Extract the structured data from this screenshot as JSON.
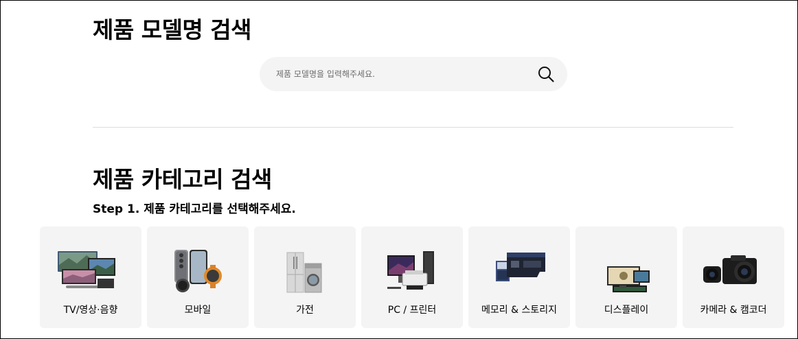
{
  "model_search": {
    "title": "제품 모델명 검색",
    "placeholder": "제품 모델명을 입력해주세요."
  },
  "category_search": {
    "title": "제품 카테고리 검색",
    "step": "Step 1. 제품 카테고리를 선택해주세요.",
    "categories": [
      {
        "label": "TV/영상·음향"
      },
      {
        "label": "모바일"
      },
      {
        "label": "가전"
      },
      {
        "label": "PC / 프린터"
      },
      {
        "label": "메모리 & 스토리지"
      },
      {
        "label": "디스플레이"
      },
      {
        "label": "카메라 & 캠코더"
      }
    ]
  },
  "icons": [
    "search-icon"
  ],
  "colors": {
    "background": "#ffffff",
    "search_bg": "#f4f4f4",
    "card_bg": "#f4f4f4",
    "divider": "#dcdcdc",
    "text": "#000000"
  }
}
